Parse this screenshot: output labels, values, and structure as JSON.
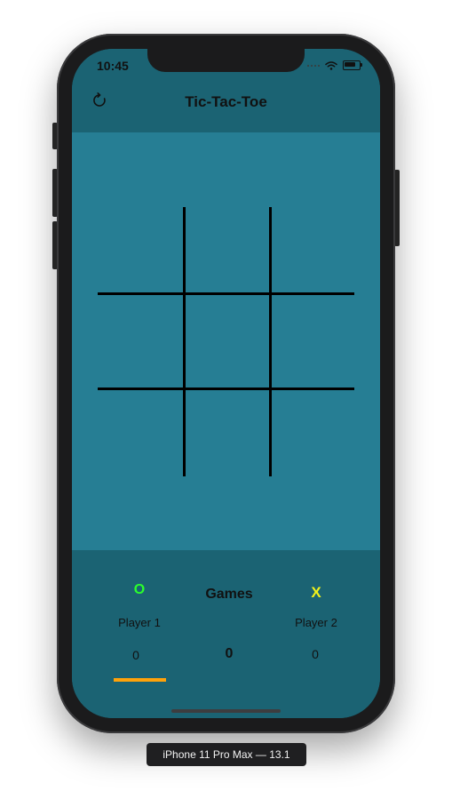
{
  "status_bar": {
    "time": "10:45",
    "icons": [
      "signal-icon",
      "wifi-icon",
      "battery-icon"
    ]
  },
  "navbar": {
    "title": "Tic-Tac-Toe",
    "refresh_icon": "refresh-icon"
  },
  "board": {
    "cells": [
      "",
      "",
      "",
      "",
      "",
      "",
      "",
      "",
      ""
    ]
  },
  "scoreboard": {
    "player1": {
      "mark": "O",
      "name": "Player 1",
      "score": "0",
      "color": "#2bff2b"
    },
    "player2": {
      "mark": "X",
      "name": "Player 2",
      "score": "0",
      "color": "#f2f21a"
    },
    "games_label": "Games",
    "games_count": "0",
    "active_turn_color": "#ffa20a"
  },
  "device_label": "iPhone 11 Pro Max — 13.1",
  "colors": {
    "header_bg": "#1b6373",
    "board_bg": "#267e94"
  }
}
